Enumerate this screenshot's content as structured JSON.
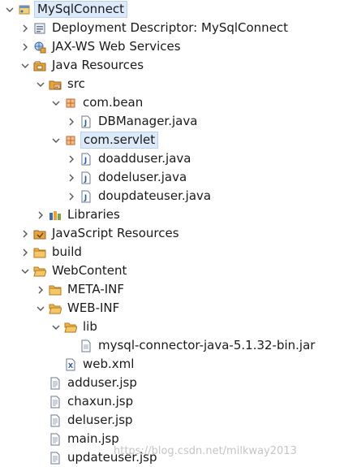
{
  "tree": [
    {
      "label": "MySqlConnect",
      "icon": "project-icon",
      "expander": "expanded",
      "level": 0,
      "selected": true
    },
    {
      "label": "Deployment Descriptor: MySqlConnect",
      "icon": "deployment-descriptor-icon",
      "expander": "collapsed",
      "level": 1
    },
    {
      "label": "JAX-WS Web Services",
      "icon": "web-services-icon",
      "expander": "collapsed",
      "level": 1
    },
    {
      "label": "Java Resources",
      "icon": "java-resources-icon",
      "expander": "expanded",
      "level": 1
    },
    {
      "label": "src",
      "icon": "source-folder-icon",
      "expander": "expanded",
      "level": 2
    },
    {
      "label": "com.bean",
      "icon": "package-icon",
      "expander": "expanded",
      "level": 3
    },
    {
      "label": "DBManager.java",
      "icon": "java-file-icon",
      "expander": "collapsed",
      "level": 4
    },
    {
      "label": "com.servlet",
      "icon": "package-icon",
      "expander": "expanded",
      "level": 3,
      "selected": true
    },
    {
      "label": "doadduser.java",
      "icon": "java-file-icon",
      "expander": "collapsed",
      "level": 4
    },
    {
      "label": "dodeluser.java",
      "icon": "java-file-icon",
      "expander": "collapsed",
      "level": 4
    },
    {
      "label": "doupdateuser.java",
      "icon": "java-file-icon",
      "expander": "collapsed",
      "level": 4
    },
    {
      "label": "Libraries",
      "icon": "libraries-icon",
      "expander": "collapsed",
      "level": 2
    },
    {
      "label": "JavaScript Resources",
      "icon": "javascript-resources-icon",
      "expander": "collapsed",
      "level": 1
    },
    {
      "label": "build",
      "icon": "folder-icon",
      "expander": "collapsed",
      "level": 1
    },
    {
      "label": "WebContent",
      "icon": "folder-open-icon",
      "expander": "expanded",
      "level": 1
    },
    {
      "label": "META-INF",
      "icon": "folder-icon",
      "expander": "collapsed",
      "level": 2
    },
    {
      "label": "WEB-INF",
      "icon": "folder-open-icon",
      "expander": "expanded",
      "level": 2
    },
    {
      "label": "lib",
      "icon": "folder-open-icon",
      "expander": "expanded",
      "level": 3
    },
    {
      "label": "mysql-connector-java-5.1.32-bin.jar",
      "icon": "jar-file-icon",
      "expander": "none",
      "level": 4
    },
    {
      "label": "web.xml",
      "icon": "xml-file-icon",
      "expander": "none",
      "level": 3
    },
    {
      "label": "adduser.jsp",
      "icon": "jsp-file-icon",
      "expander": "none",
      "level": 2
    },
    {
      "label": "chaxun.jsp",
      "icon": "jsp-file-icon",
      "expander": "none",
      "level": 2
    },
    {
      "label": "deluser.jsp",
      "icon": "jsp-file-icon",
      "expander": "none",
      "level": 2
    },
    {
      "label": "main.jsp",
      "icon": "jsp-file-icon",
      "expander": "none",
      "level": 2
    },
    {
      "label": "updateuser.jsp",
      "icon": "jsp-file-icon",
      "expander": "none",
      "level": 2
    }
  ],
  "watermark": "https://blog.csdn.net/milkway2013",
  "colors": {
    "folder": "#e8a33d",
    "folder_dark": "#c9822a",
    "package": "#c8662b",
    "java": "#2a5aa8",
    "selection": "#dce9f8"
  }
}
